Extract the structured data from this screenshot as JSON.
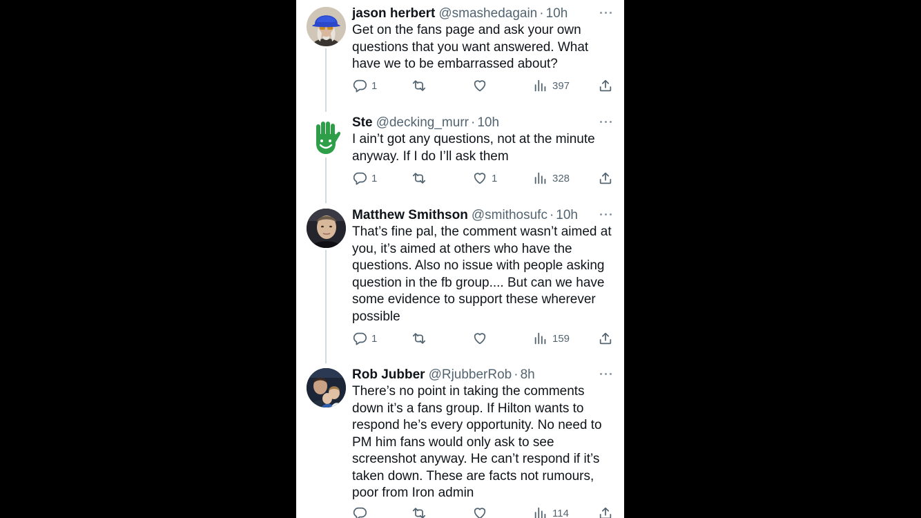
{
  "tweets": [
    {
      "name": "jason herbert",
      "handle": "@smashedagain",
      "time": "10h",
      "text": "Get on the fans page and ask your own questions that you want answered. What have we to be embarrassed about?",
      "avatar_icon": "avatar-man-blue-hat",
      "replies": "1",
      "retweets": "",
      "likes": "",
      "views": "397"
    },
    {
      "name": "Ste",
      "handle": "@decking_murr",
      "time": "10h",
      "text": "I ain’t got any questions, not at the minute anyway. If I do I’ll ask them",
      "avatar_icon": "avatar-green-hand",
      "replies": "1",
      "retweets": "",
      "likes": "1",
      "views": "328"
    },
    {
      "name": "Matthew Smithson",
      "handle": "@smithosufc",
      "time": "10h",
      "text": "That’s fine pal, the comment wasn’t aimed at you, it’s aimed at others who have the questions. Also no issue with people asking question in the fb group.... But can we have some evidence to support these wherever possible",
      "avatar_icon": "avatar-man-selfie",
      "replies": "1",
      "retweets": "",
      "likes": "",
      "views": "159"
    },
    {
      "name": "Rob Jubber",
      "handle": "@RjubberRob",
      "time": "8h",
      "text": "There’s no point in taking the comments down it’s a fans group. If Hilton wants to respond he’s every opportunity. No need to PM him fans would only ask to see screenshot anyway. He can’t respond if it’s taken down. These are facts not rumours, poor from Iron admin",
      "avatar_icon": "avatar-family-photo",
      "replies": "",
      "retweets": "",
      "likes": "",
      "views": "114"
    }
  ],
  "colors": {
    "text": "#0f1419",
    "secondary": "#536471",
    "thread_line": "#cfd9de",
    "background": "#ffffff",
    "outer": "#000000"
  }
}
